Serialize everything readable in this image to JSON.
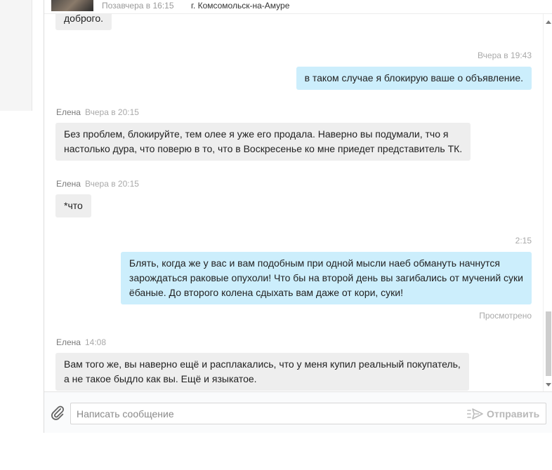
{
  "header": {
    "last_seen": "Позавчера в 16:15",
    "city": "г. Комсомольск-на-Амуре"
  },
  "messages": [
    {
      "direction": "in",
      "lines": [
        "доброго."
      ]
    },
    {
      "direction": "out",
      "time": "Вчера в 19:43",
      "lines": [
        "в таком случае я блокирую ваше о объявление."
      ]
    },
    {
      "direction": "in",
      "author": "Елена",
      "time": "Вчера в 20:15",
      "lines": [
        "Без проблем, блокируйте, тем олее я уже его продала. Наверно вы подумали, тчо я",
        "настолько дура, что поверю в то, что в Воскресенье ко мне приедет представитель ТК."
      ]
    },
    {
      "direction": "in",
      "author": "Елена",
      "time": "Вчера в 20:15",
      "lines": [
        "*что"
      ]
    },
    {
      "direction": "out",
      "time": "2:15",
      "lines": [
        "Блять, когда же у вас и вам подобным при одной мысли наеб обмануть начнутся",
        "зарождаться раковые опухоли! Что бы на второй день вы загибались от мучений суки",
        "ёбаные. До второго колена сдыхать вам даже от кори, суки!"
      ],
      "status": "Просмотрено"
    },
    {
      "direction": "in",
      "author": "Елена",
      "time": "14:08",
      "lines": [
        "Вам того же, вы наверно ещё и расплакались, что у меня купил реальный покупатель,",
        "а не такое быдло как вы. Ещё и языкатое."
      ]
    }
  ],
  "composer": {
    "placeholder": "Написать сообщение",
    "send_label": "Отправить",
    "attach_icon": "paperclip-icon",
    "send_icon": "send-arrow-icon"
  },
  "colors": {
    "incoming_bubble": "#eeeeee",
    "outgoing_bubble": "#cceefc",
    "meta_text": "#a9a9a9",
    "author_text": "#7a7a7a"
  }
}
